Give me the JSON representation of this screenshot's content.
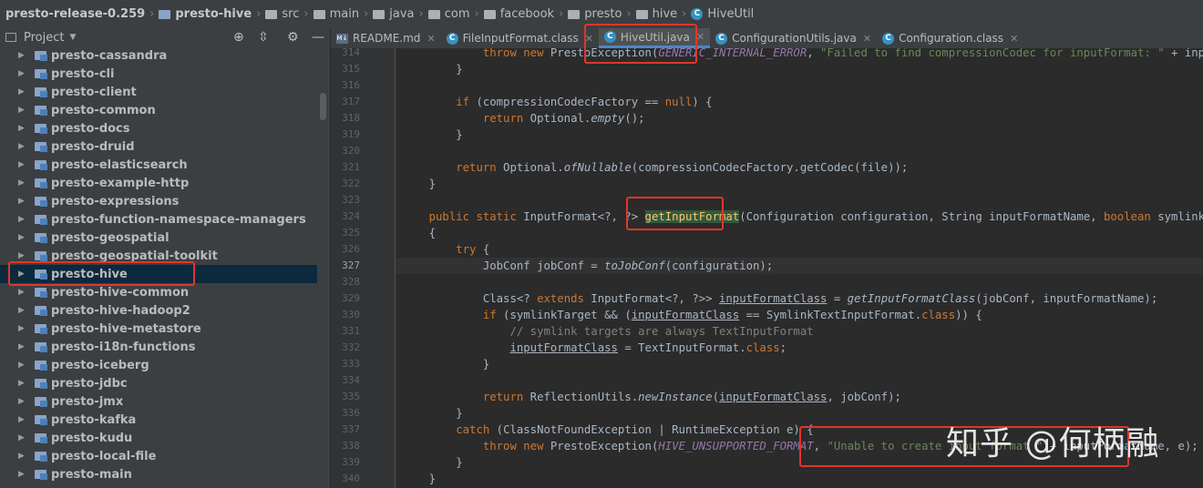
{
  "breadcrumb": [
    {
      "label": "presto-release-0.259",
      "icon": "folder-icon",
      "bold": true
    },
    {
      "label": "presto-hive",
      "icon": "folder-icon",
      "bold": true
    },
    {
      "label": "src",
      "icon": "folder-icon",
      "bold": false
    },
    {
      "label": "main",
      "icon": "folder-icon",
      "bold": false
    },
    {
      "label": "java",
      "icon": "folder-icon",
      "bold": false
    },
    {
      "label": "com",
      "icon": "folder-icon",
      "bold": false
    },
    {
      "label": "facebook",
      "icon": "folder-icon",
      "bold": false
    },
    {
      "label": "presto",
      "icon": "folder-icon",
      "bold": false
    },
    {
      "label": "hive",
      "icon": "folder-icon",
      "bold": false
    },
    {
      "label": "HiveUtil",
      "icon": "class-icon",
      "bold": false
    }
  ],
  "project_panel": {
    "title": "Project",
    "tree": [
      "presto-cassandra",
      "presto-cli",
      "presto-client",
      "presto-common",
      "presto-docs",
      "presto-druid",
      "presto-elasticsearch",
      "presto-example-http",
      "presto-expressions",
      "presto-function-namespace-managers",
      "presto-geospatial",
      "presto-geospatial-toolkit",
      "presto-hive",
      "presto-hive-common",
      "presto-hive-hadoop2",
      "presto-hive-metastore",
      "presto-i18n-functions",
      "presto-iceberg",
      "presto-jdbc",
      "presto-jmx",
      "presto-kafka",
      "presto-kudu",
      "presto-local-file",
      "presto-main"
    ],
    "selected_index": 12
  },
  "tabs": [
    {
      "label": "README.md",
      "icon": "markdown-icon",
      "active": false
    },
    {
      "label": "FileInputFormat.class",
      "icon": "class-icon",
      "active": false
    },
    {
      "label": "HiveUtil.java",
      "icon": "class-icon",
      "active": true
    },
    {
      "label": "ConfigurationUtils.java",
      "icon": "class-icon",
      "active": false
    },
    {
      "label": "Configuration.class",
      "icon": "class-icon",
      "active": false
    }
  ],
  "editor": {
    "current_line": 327,
    "lines": [
      {
        "n": 314,
        "html": "            <span class=\"kw\">throw new</span> PrestoException(<span class=\"cn\">GENERIC_INTERNAL_ERROR</span>, <span class=\"st\">\"Failed to find compressionCodec for inputFormat: \"</span> + inputFormatName);"
      },
      {
        "n": 315,
        "html": "        }"
      },
      {
        "n": 316,
        "html": ""
      },
      {
        "n": 317,
        "html": "        <span class=\"kw\">if</span> (compressionCodecFactory == <span class=\"kw\">null</span>) {"
      },
      {
        "n": 318,
        "html": "            <span class=\"kw\">return</span> Optional.<span class=\"it\">empty</span>();"
      },
      {
        "n": 319,
        "html": "        }"
      },
      {
        "n": 320,
        "html": ""
      },
      {
        "n": 321,
        "html": "        <span class=\"kw\">return</span> Optional.<span class=\"it\">ofNullable</span>(compressionCodecFactory.getCodec(file));"
      },
      {
        "n": 322,
        "html": "    }"
      },
      {
        "n": 323,
        "html": ""
      },
      {
        "n": 324,
        "html": "    <span class=\"kw\">public static</span> InputFormat&lt;?, ?&gt; <span class=\"hl\">getInputFormat</span>(Configuration configuration, String inputFormatName, <span class=\"kw\">boolean</span> symlinkTarget)"
      },
      {
        "n": 325,
        "html": "    {"
      },
      {
        "n": 326,
        "html": "        <span class=\"kw\">try</span> {"
      },
      {
        "n": 327,
        "html": "            JobConf jobConf = <span class=\"it\">toJobConf</span>(configuration);"
      },
      {
        "n": 328,
        "html": ""
      },
      {
        "n": 329,
        "html": "            Class&lt;? <span class=\"kw\">extends</span> InputFormat&lt;?, ?&gt;&gt; <span class=\"ul\">inputFormatClass</span> = <span class=\"it\">getInputFormatClass</span>(jobConf, inputFormatName);"
      },
      {
        "n": 330,
        "html": "            <span class=\"kw\">if</span> (symlinkTarget &amp;&amp; (<span class=\"ul\">inputFormatClass</span> == SymlinkTextInputFormat.<span class=\"kw\">class</span>)) {"
      },
      {
        "n": 331,
        "html": "                <span class=\"cm\">// symlink targets are always TextInputFormat</span>"
      },
      {
        "n": 332,
        "html": "                <span class=\"ul\">inputFormatClass</span> = TextInputFormat.<span class=\"kw\">class</span>;"
      },
      {
        "n": 333,
        "html": "            }"
      },
      {
        "n": 334,
        "html": ""
      },
      {
        "n": 335,
        "html": "            <span class=\"kw\">return</span> ReflectionUtils.<span class=\"it\">newInstance</span>(<span class=\"ul\">inputFormatClass</span>, jobConf);"
      },
      {
        "n": 336,
        "html": "        }"
      },
      {
        "n": 337,
        "html": "        <span class=\"kw\">catch</span> (ClassNotFoundException | RuntimeException e) {"
      },
      {
        "n": 338,
        "html": "            <span class=\"kw\">throw new</span> PrestoException(<span class=\"cn\">HIVE_UNSUPPORTED_FORMAT</span>, <span class=\"st\">\"Unable to create input format \"</span> + inputFormatName, e);"
      },
      {
        "n": 339,
        "html": "        }"
      },
      {
        "n": 340,
        "html": "    }"
      }
    ]
  },
  "watermark": "知乎 @何柄融"
}
